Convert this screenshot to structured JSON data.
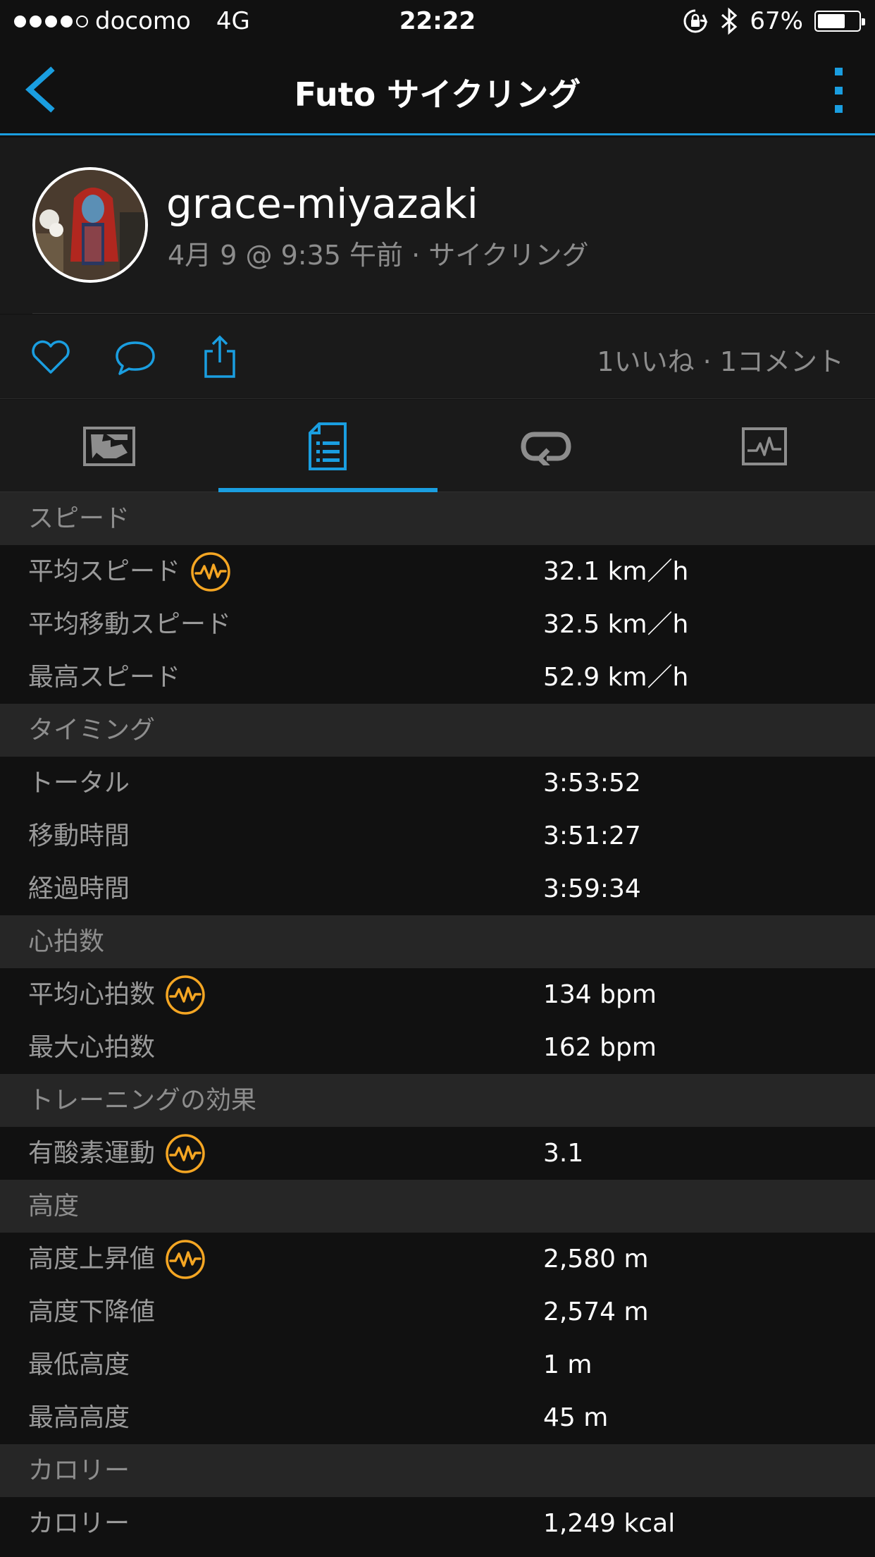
{
  "status_bar": {
    "carrier": "docomo",
    "network": "4G",
    "time": "22:22",
    "battery": "67%",
    "battery_level": 0.67
  },
  "nav": {
    "title": "Futo サイクリング",
    "back_icon": "chevron-left-icon",
    "more_icon": "more-vertical-icon"
  },
  "profile": {
    "username": "grace-miyazaki",
    "subtitle": "4月 9 @ 9:35 午前 · サイクリング"
  },
  "actions": {
    "counts": "1いいね ·  1コメント"
  },
  "tabs": [
    {
      "name": "map",
      "icon": "map-icon",
      "active": false
    },
    {
      "name": "details",
      "icon": "details-icon",
      "active": true
    },
    {
      "name": "laps",
      "icon": "laps-icon",
      "active": false
    },
    {
      "name": "chart",
      "icon": "chart-icon",
      "active": false
    }
  ],
  "colors": {
    "accent": "#1a9ee0",
    "effect": "#f5a623",
    "background": "#111111",
    "section": "#262626",
    "muted": "#8d8d8d"
  },
  "sections": {
    "speed": {
      "title": "スピード",
      "rows": [
        {
          "label": "平均スピード",
          "value": "32.1 km／h",
          "effect": true
        },
        {
          "label": "平均移動スピード",
          "value": "32.5 km／h",
          "effect": false
        },
        {
          "label": "最高スピード",
          "value": "52.9 km／h",
          "effect": false
        }
      ]
    },
    "timing": {
      "title": "タイミング",
      "rows": [
        {
          "label": "トータル",
          "value": "3:53:52"
        },
        {
          "label": "移動時間",
          "value": "3:51:27"
        },
        {
          "label": "経過時間",
          "value": "3:59:34"
        }
      ]
    },
    "heart_rate": {
      "title": "心拍数",
      "rows": [
        {
          "label": "平均心拍数",
          "value": "134 bpm",
          "effect": true
        },
        {
          "label": "最大心拍数",
          "value": "162 bpm"
        }
      ]
    },
    "training": {
      "title": "トレーニングの効果",
      "rows": [
        {
          "label": "有酸素運動",
          "value": "3.1",
          "effect": true
        }
      ]
    },
    "elevation": {
      "title": "高度",
      "rows": [
        {
          "label": "高度上昇値",
          "value": "2,580 m",
          "effect": true
        },
        {
          "label": "高度下降値",
          "value": "2,574 m"
        },
        {
          "label": "最低高度",
          "value": "1 m"
        },
        {
          "label": "最高高度",
          "value": "45 m"
        }
      ]
    },
    "calories": {
      "title": "カロリー",
      "rows": [
        {
          "label": "カロリー",
          "value": "1,249 kcal"
        }
      ]
    }
  }
}
